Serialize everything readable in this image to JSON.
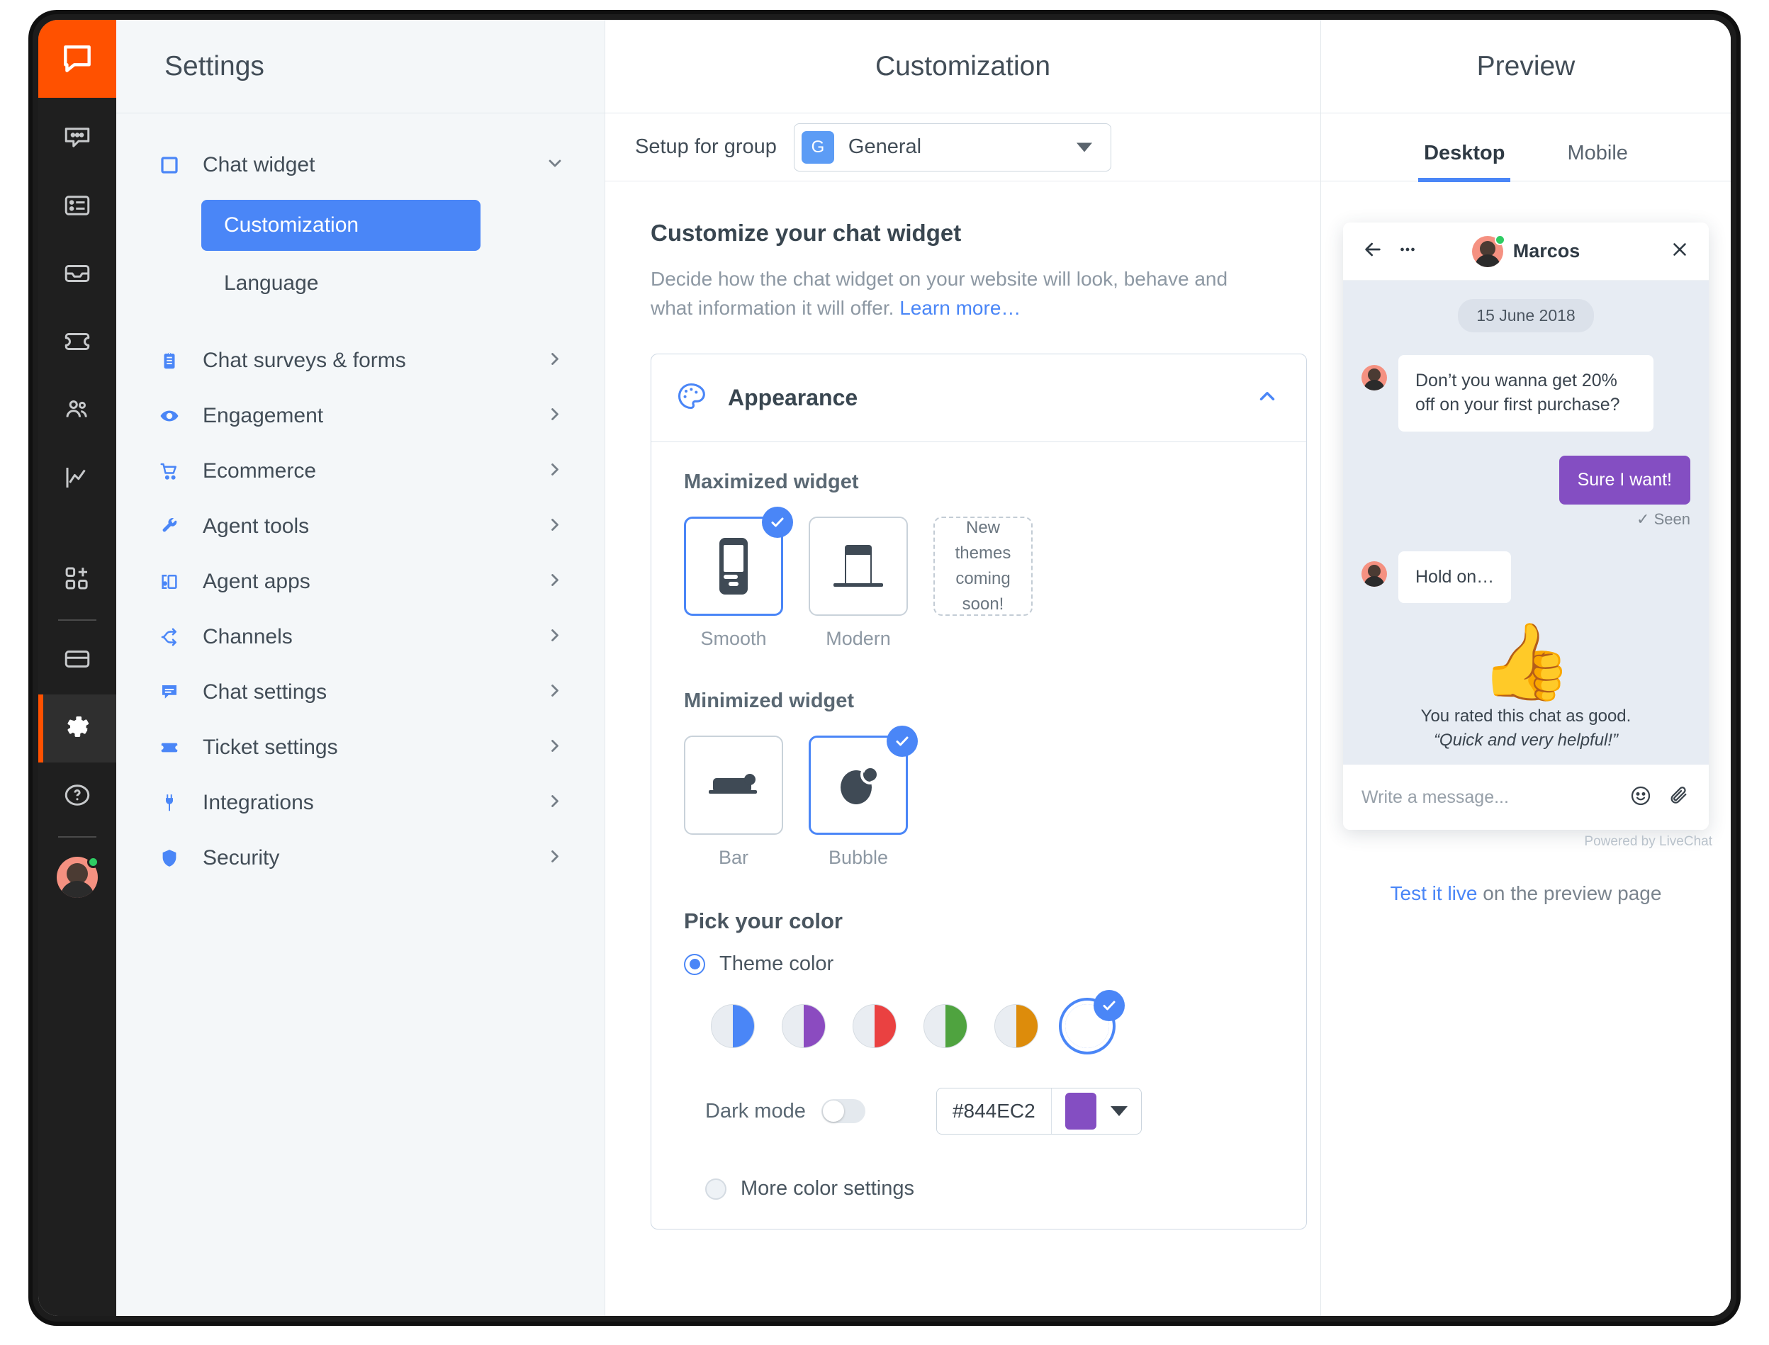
{
  "rail": {
    "logo_icon": "livechat-logo-icon",
    "items": [
      {
        "icon": "chats-icon",
        "name": "chats"
      },
      {
        "icon": "archives-list-icon",
        "name": "archives"
      },
      {
        "icon": "tickets-inbox-icon",
        "name": "inbox"
      },
      {
        "icon": "ticket-icon",
        "name": "tickets"
      },
      {
        "icon": "team-icon",
        "name": "team"
      },
      {
        "icon": "reports-chart-icon",
        "name": "reports"
      },
      {
        "icon": "apps-plus-icon",
        "name": "apps"
      },
      {
        "icon": "billing-card-icon",
        "name": "billing"
      },
      {
        "icon": "gear-icon",
        "name": "settings"
      },
      {
        "icon": "help-question-icon",
        "name": "help"
      }
    ]
  },
  "settings": {
    "title": "Settings",
    "nav": [
      {
        "label": "Chat widget",
        "icon": "chat-widget-icon",
        "chevron": "down",
        "expanded": true
      },
      {
        "label": "Chat surveys & forms",
        "icon": "clipboard-icon",
        "chevron": "right"
      },
      {
        "label": "Engagement",
        "icon": "eye-icon",
        "chevron": "right"
      },
      {
        "label": "Ecommerce",
        "icon": "cart-icon",
        "chevron": "right"
      },
      {
        "label": "Agent tools",
        "icon": "wrench-icon",
        "chevron": "right"
      },
      {
        "label": "Agent apps",
        "icon": "agent-apps-icon",
        "chevron": "right"
      },
      {
        "label": "Channels",
        "icon": "channels-icon",
        "chevron": "right"
      },
      {
        "label": "Chat settings",
        "icon": "chat-settings-icon",
        "chevron": "right"
      },
      {
        "label": "Ticket settings",
        "icon": "ticket-settings-icon",
        "chevron": "right"
      },
      {
        "label": "Integrations",
        "icon": "plug-icon",
        "chevron": "right"
      },
      {
        "label": "Security",
        "icon": "shield-icon",
        "chevron": "right"
      }
    ],
    "subnav": [
      {
        "label": "Customization",
        "active": true
      },
      {
        "label": "Language",
        "active": false
      }
    ]
  },
  "customization": {
    "title": "Customization",
    "setup_label": "Setup for group",
    "group_badge": "G",
    "group_name": "General",
    "heading": "Customize your chat widget",
    "description": "Decide how the chat widget on your website will look, behave and what information it will offer.",
    "learn_more": "Learn more…",
    "appearance": {
      "card_title": "Appearance",
      "card_icon": "palette-icon",
      "collapse_icon": "chevron-up-icon",
      "maximized_label": "Maximized widget",
      "maximized_options": [
        {
          "label": "Smooth",
          "selected": true
        },
        {
          "label": "Modern",
          "selected": false
        }
      ],
      "coming_soon": "New themes coming soon!",
      "minimized_label": "Minimized widget",
      "minimized_options": [
        {
          "label": "Bar",
          "selected": false
        },
        {
          "label": "Bubble",
          "selected": true
        }
      ],
      "pick_color_label": "Pick your color",
      "theme_color_label": "Theme color",
      "theme_color_selected": true,
      "swatches": [
        {
          "color": "#4a86f7",
          "name": "blue"
        },
        {
          "color": "#8b4bc0",
          "name": "purple"
        },
        {
          "color": "#ea4141",
          "name": "red"
        },
        {
          "color": "#4fa33f",
          "name": "green"
        },
        {
          "color": "#dd8c0b",
          "name": "orange"
        },
        {
          "color": "wheel",
          "name": "custom-wheel",
          "selected": true
        }
      ],
      "dark_mode_label": "Dark mode",
      "dark_mode_on": false,
      "hex_value": "#844EC2",
      "hex_swatch": "#844EC2",
      "more_color_settings_label": "More color settings",
      "more_color_settings_selected": false
    }
  },
  "preview": {
    "title": "Preview",
    "tabs": [
      {
        "label": "Desktop",
        "active": true
      },
      {
        "label": "Mobile",
        "active": false
      }
    ],
    "widget": {
      "back_icon": "arrow-left-icon",
      "menu_icon": "ellipsis-icon",
      "close_icon": "close-icon",
      "agent_name": "Marcos",
      "date_pill": "15 June 2018",
      "messages": [
        {
          "from": "agent",
          "text": "Don’t you wanna get 20% off on your first purchase?"
        },
        {
          "from": "visitor",
          "text": "Sure I want!",
          "status": "Seen"
        },
        {
          "from": "agent",
          "text": "Hold on…"
        }
      ],
      "rating_emoji": "👍",
      "rating_text": "You rated this chat as good.",
      "rating_comment": "“Quick and very helpful!”",
      "input_placeholder": "Write a message...",
      "emoji_icon": "smiley-icon",
      "attach_icon": "paperclip-icon",
      "powered_by": "Powered by LiveChat"
    },
    "footer_link": "Test it live",
    "footer_text": " on the preview page"
  }
}
